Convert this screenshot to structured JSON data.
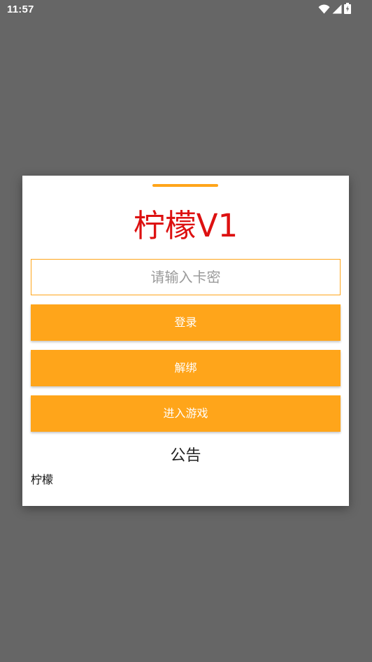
{
  "status_bar": {
    "time": "11:57",
    "icons": [
      "wifi-icon",
      "cell-signal-icon",
      "battery-charging-icon"
    ]
  },
  "dialog": {
    "title": "柠檬V1",
    "key_input": {
      "placeholder": "请输入卡密",
      "value": ""
    },
    "buttons": {
      "login": "登录",
      "unbind": "解绑",
      "enter_game": "进入游戏"
    },
    "notice": {
      "title": "公告",
      "body": "柠檬"
    }
  },
  "colors": {
    "accent": "#ffa51a",
    "title": "#dd1111",
    "backdrop": "#666666"
  }
}
